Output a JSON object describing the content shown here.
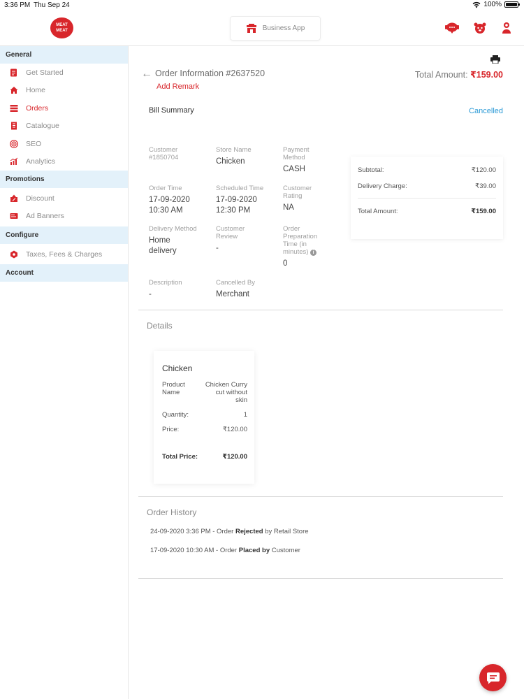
{
  "status_bar": {
    "time": "3:36 PM",
    "date": "Thu Sep 24",
    "battery": "100%"
  },
  "header": {
    "logo_text": "MEAT MEAT",
    "business_app_label": "Business App"
  },
  "sidebar": {
    "sections": [
      {
        "title": "General",
        "items": [
          {
            "label": "Get Started",
            "icon": "checklist-icon"
          },
          {
            "label": "Home",
            "icon": "home-icon"
          },
          {
            "label": "Orders",
            "icon": "orders-icon",
            "active": true
          },
          {
            "label": "Catalogue",
            "icon": "catalogue-icon"
          },
          {
            "label": "SEO",
            "icon": "target-icon"
          },
          {
            "label": "Analytics",
            "icon": "analytics-icon"
          }
        ]
      },
      {
        "title": "Promotions",
        "items": [
          {
            "label": "Discount",
            "icon": "discount-icon"
          },
          {
            "label": "Ad Banners",
            "icon": "banner-icon"
          }
        ]
      },
      {
        "title": "Configure",
        "items": [
          {
            "label": "Taxes, Fees & Charges",
            "icon": "tax-icon"
          }
        ]
      },
      {
        "title": "Account",
        "items": []
      }
    ]
  },
  "order": {
    "title": "Order Information #2637520",
    "add_remark": "Add Remark",
    "total_label": "Total Amount:",
    "total_value": "₹159.00",
    "bill_summary": "Bill Summary",
    "status": "Cancelled",
    "fields": {
      "customer_label": "Customer",
      "customer_value": "#1850704",
      "store_label": "Store Name",
      "store_value": "Chicken",
      "payment_label": "Payment Method",
      "payment_value": "CASH",
      "order_time_label": "Order Time",
      "order_time_value": "17-09-2020 10:30 AM",
      "scheduled_label": "Scheduled Time",
      "scheduled_value": "17-09-2020 12:30 PM",
      "rating_label": "Customer Rating",
      "rating_value": "NA",
      "delivery_label": "Delivery Method",
      "delivery_value": "Home delivery",
      "review_label": "Customer Review",
      "review_value": "-",
      "prep_label": "Order Preparation Time (in minutes)",
      "prep_value": "0",
      "desc_label": "Description",
      "desc_value": "-",
      "cancelled_by_label": "Cancelled By",
      "cancelled_by_value": "Merchant"
    },
    "summary": {
      "subtotal_label": "Subtotal:",
      "subtotal_value": "₹120.00",
      "delivery_label": "Delivery Charge:",
      "delivery_value": "₹39.00",
      "total_label": "Total Amount:",
      "total_value": "₹159.00"
    }
  },
  "details": {
    "heading": "Details",
    "product": {
      "name": "Chicken",
      "product_name_label": "Product Name",
      "product_name_value": "Chicken Curry cut without skin",
      "quantity_label": "Quantity:",
      "quantity_value": "1",
      "price_label": "Price:",
      "price_value": "₹120.00",
      "total_label": "Total Price:",
      "total_value": "₹120.00"
    }
  },
  "history": {
    "heading": "Order History",
    "entries": [
      {
        "time": "24-09-2020 3:36 PM - Order",
        "action": "Rejected",
        "by": "by Retail Store"
      },
      {
        "time": "17-09-2020 10:30 AM - Order",
        "action": "Placed by",
        "by": "Customer"
      }
    ]
  },
  "colors": {
    "accent": "#d8262b",
    "status_cancelled": "#2b9ad6",
    "section_bg": "#e3f1fa"
  }
}
